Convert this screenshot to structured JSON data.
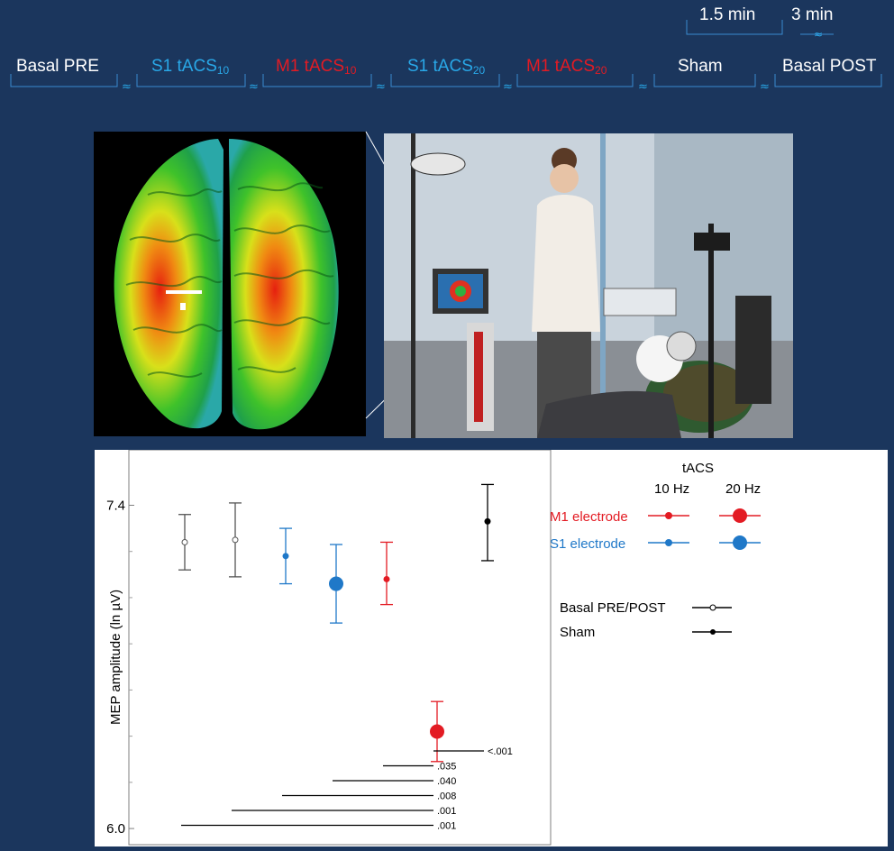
{
  "timeline": {
    "durations": {
      "short": "1.5 min",
      "long": "3 min"
    },
    "segments": [
      {
        "label": "Basal PRE",
        "sub": "",
        "color": "white"
      },
      {
        "label": "S1 tACS",
        "sub": "10",
        "color": "blue"
      },
      {
        "label": "M1 tACS",
        "sub": "10",
        "color": "red"
      },
      {
        "label": "S1 tACS",
        "sub": "20",
        "color": "blue"
      },
      {
        "label": "M1 tACS",
        "sub": "20",
        "color": "red"
      },
      {
        "label": "Sham",
        "sub": "",
        "color": "white"
      },
      {
        "label": "Basal POST",
        "sub": "",
        "color": "white"
      }
    ]
  },
  "images": {
    "brain": "brain-current-density-map",
    "photo": "tacs-tms-lab-setup-photo"
  },
  "colors": {
    "background": "#1b365d",
    "blue": "#1f78c8",
    "red": "#e31b23",
    "gray": "#555555",
    "black": "#000000"
  },
  "chart_data": {
    "type": "scatter",
    "ylabel": "MEP amplitude (ln µV)",
    "ytick_labels": [
      "7.4",
      "6.0"
    ],
    "ylim": [
      5.93,
      7.64
    ],
    "points": [
      {
        "group": "Basal PRE",
        "mean": 7.24,
        "lo": 7.12,
        "hi": 7.36,
        "color": "gray",
        "marker": "open",
        "size": "small"
      },
      {
        "group": "Basal POST",
        "mean": 7.25,
        "lo": 7.09,
        "hi": 7.41,
        "color": "gray",
        "marker": "open",
        "size": "small"
      },
      {
        "group": "S1 tACS 10 Hz",
        "mean": 7.18,
        "lo": 7.06,
        "hi": 7.3,
        "color": "blue",
        "marker": "filled",
        "size": "small"
      },
      {
        "group": "S1 tACS 20 Hz",
        "mean": 7.06,
        "lo": 6.89,
        "hi": 7.23,
        "color": "blue",
        "marker": "filled",
        "size": "large"
      },
      {
        "group": "M1 tACS 10 Hz",
        "mean": 7.08,
        "lo": 6.97,
        "hi": 7.24,
        "color": "red",
        "marker": "filled",
        "size": "small"
      },
      {
        "group": "M1 tACS 20 Hz",
        "mean": 6.42,
        "lo": 6.29,
        "hi": 6.55,
        "color": "red",
        "marker": "filled",
        "size": "large"
      },
      {
        "group": "Sham",
        "mean": 7.33,
        "lo": 7.16,
        "hi": 7.49,
        "color": "black",
        "marker": "filled",
        "size": "small"
      }
    ],
    "p_values": [
      {
        "label": "<.001",
        "from": "M1 tACS 20 Hz"
      },
      {
        "label": ".035",
        "from": "M1 tACS 10 Hz"
      },
      {
        "label": ".040",
        "from": "S1 tACS 20 Hz"
      },
      {
        "label": ".008",
        "from": "S1 tACS 10 Hz"
      },
      {
        "label": ".001",
        "from": "Basal POST"
      },
      {
        "label": ".001",
        "from": "Basal PRE"
      }
    ],
    "legend": {
      "title": "tACS",
      "col1": "10 Hz",
      "col2": "20 Hz",
      "m1": "M1 electrode",
      "s1": "S1 electrode",
      "basal": "Basal PRE/POST",
      "sham": "Sham"
    }
  }
}
